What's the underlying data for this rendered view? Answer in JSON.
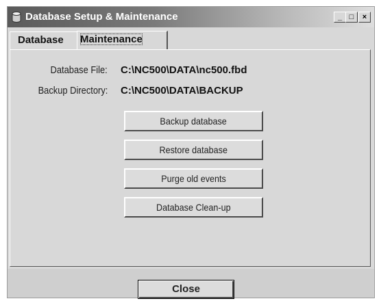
{
  "window": {
    "title": "Database Setup & Maintenance",
    "icon": "database-icon",
    "controls": {
      "minimize": "_",
      "maximize": "□",
      "close": "×"
    }
  },
  "tabs": [
    {
      "label": "Database",
      "active": false
    },
    {
      "label": "Maintenance",
      "active": true
    }
  ],
  "maintenance": {
    "database_file_label": "Database File:",
    "database_file_value": "C:\\NC500\\DATA\\nc500.fbd",
    "backup_dir_label": "Backup Directory:",
    "backup_dir_value": "C:\\NC500\\DATA\\BACKUP",
    "buttons": [
      "Backup database",
      "Restore database",
      "Purge old events",
      "Database Clean-up"
    ]
  },
  "footer": {
    "close_label": "Close"
  }
}
